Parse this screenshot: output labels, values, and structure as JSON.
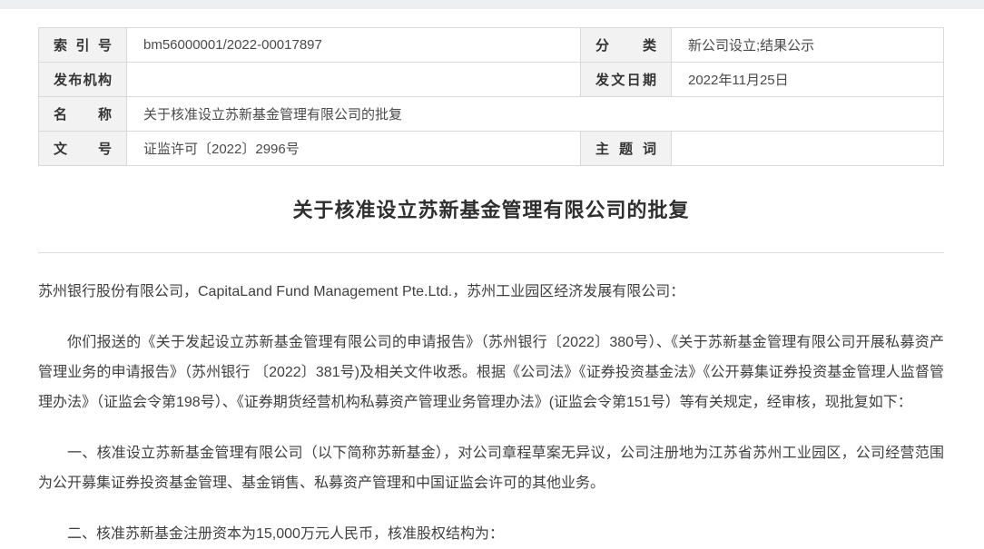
{
  "page": {
    "background_color": "#ffffff",
    "top_strip_color": "#edeff1"
  },
  "meta_table": {
    "header_bg_color": "#f2f2f2",
    "border_color": "#c9ced3",
    "rows": {
      "r1": {
        "label1": "索引号",
        "value1": "bm56000001/2022-00017897",
        "label2": "分类",
        "value2": "新公司设立;结果公示"
      },
      "r2": {
        "label1": "发布机构",
        "value1": "",
        "label2": "发文日期",
        "value2": "2022年11月25日"
      },
      "r3": {
        "label1": "名称",
        "value1": "关于核准设立苏新基金管理有限公司的批复"
      },
      "r4": {
        "label1": "文号",
        "value1": "证监许可〔2022〕2996号",
        "label2": "主题词",
        "value2": ""
      }
    }
  },
  "document": {
    "title": "关于核准设立苏新基金管理有限公司的批复",
    "paragraphs": {
      "salutation": "苏州银行股份有限公司，CapitaLand Fund Management Pte.Ltd.，苏州工业园区经济发展有限公司：",
      "p1": "你们报送的《关于发起设立苏新基金管理有限公司的申请报告》（苏州银行〔2022〕380号）、《关于苏新基金管理有限公司开展私募资产管理业务的申请报告》（苏州银行 〔2022〕381号)及相关文件收悉。根据《公司法》《证券投资基金法》《公开募集证券投资基金管理人监督管理办法》（证监会令第198号）、《证券期货经营机构私募资产管理业务管理办法》(证监会令第151号）等有关规定，经审核，现批复如下：",
      "p2": "一、核准设立苏新基金管理有限公司（以下简称苏新基金），对公司章程草案无异议，公司注册地为江苏省苏州工业园区，公司经营范围为公开募集证券投资基金管理、基金销售、私募资产管理和中国证监会许可的其他业务。",
      "p3": "二、核准苏新基金注册资本为15,000万元人民币，核准股权结构为："
    }
  }
}
